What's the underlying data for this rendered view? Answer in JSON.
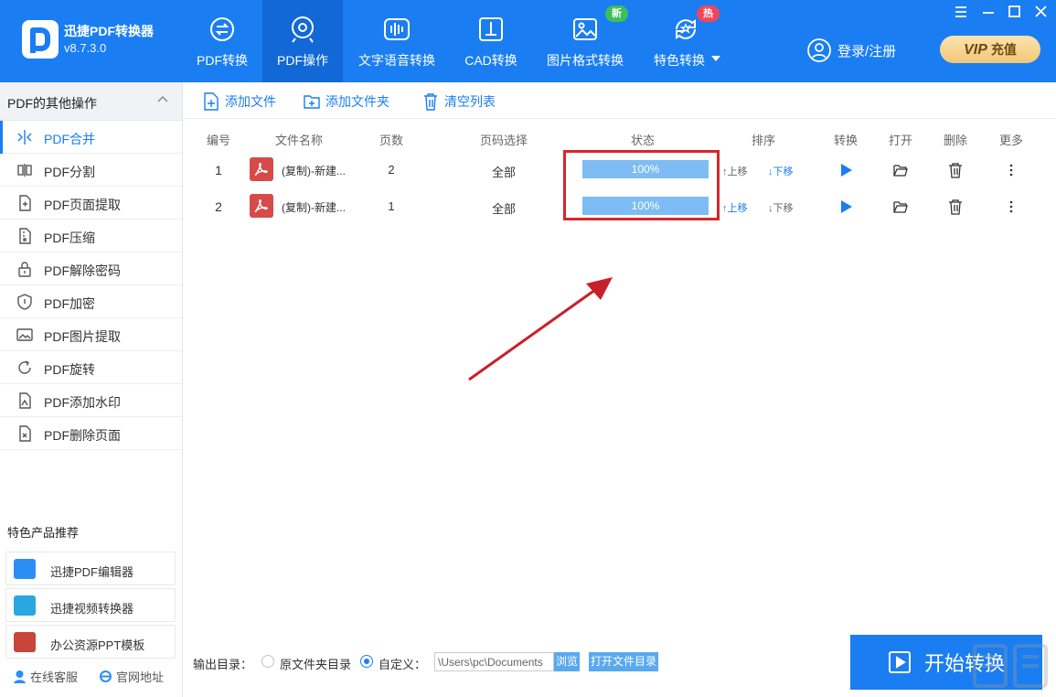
{
  "app": {
    "name": "迅捷PDF转换器",
    "version": "v8.7.3.0"
  },
  "nav": {
    "tabs": [
      {
        "label": "PDF转换"
      },
      {
        "label": "PDF操作"
      },
      {
        "label": "文字语音转换"
      },
      {
        "label": "CAD转换"
      },
      {
        "label": "图片格式转换",
        "badge": "新"
      },
      {
        "label": "特色转换",
        "badge": "热"
      }
    ]
  },
  "account": {
    "login_label": "登录/注册",
    "vip_text": "VIP",
    "recharge_label": "充值"
  },
  "sidebar": {
    "title": "PDF的其他操作",
    "items": [
      {
        "label": "PDF合并"
      },
      {
        "label": "PDF分割"
      },
      {
        "label": "PDF页面提取"
      },
      {
        "label": "PDF压缩"
      },
      {
        "label": "PDF解除密码"
      },
      {
        "label": "PDF加密"
      },
      {
        "label": "PDF图片提取"
      },
      {
        "label": "PDF旋转"
      },
      {
        "label": "PDF添加水印"
      },
      {
        "label": "PDF删除页面"
      }
    ],
    "recommend_title": "特色产品推荐",
    "recommend": [
      {
        "label": "迅捷PDF编辑器"
      },
      {
        "label": "迅捷视频转换器"
      },
      {
        "label": "办公资源PPT模板"
      }
    ],
    "footer": {
      "service": "在线客服",
      "website": "官网地址"
    }
  },
  "toolbar": {
    "add_file": "添加文件",
    "add_folder": "添加文件夹",
    "clear_list": "清空列表"
  },
  "table": {
    "headers": {
      "num": "编号",
      "name": "文件名称",
      "pages": "页数",
      "range": "页码选择",
      "status": "状态",
      "sort": "排序",
      "convert": "转换",
      "open": "打开",
      "delete": "删除",
      "more": "更多"
    },
    "up_label": "上移",
    "down_label": "下移",
    "rows": [
      {
        "num": "1",
        "name": "(复制)-新建...",
        "pages": "2",
        "range": "全部",
        "progress": 100,
        "status": "100%"
      },
      {
        "num": "2",
        "name": "(复制)-新建...",
        "pages": "1",
        "range": "全部",
        "progress": 100,
        "status": "100%"
      }
    ]
  },
  "output": {
    "label": "输出目录：",
    "option_original": "原文件夹目录",
    "option_custom": "自定义：",
    "path_value": "\\Users\\pc\\Documents",
    "browse_label": "浏览",
    "open_folder_label": "打开文件目录"
  },
  "start_label": "开始转换",
  "colors": {
    "brand": "#1a7ef2",
    "highlight": "#d9252b",
    "badge_new": "#3cbf5b",
    "badge_hot": "#f0455a"
  }
}
